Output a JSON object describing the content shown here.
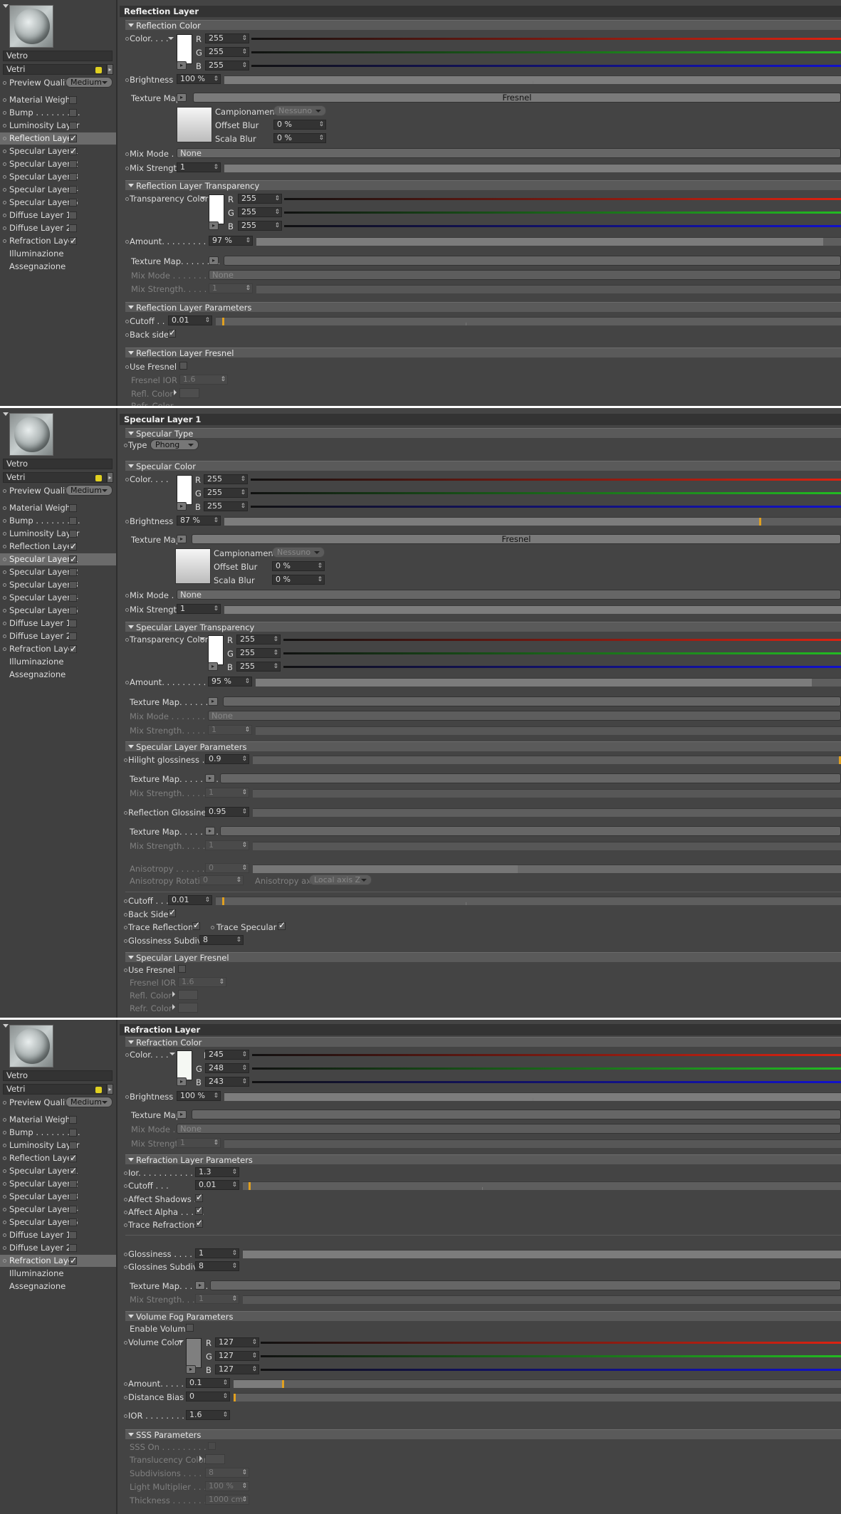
{
  "material": {
    "name": "Vetro",
    "group": "Vetri",
    "preview_quality_label": "Preview Quality",
    "preview_quality_value": "Medium"
  },
  "channels": [
    {
      "label": "Material Weight",
      "checked": false
    },
    {
      "label": "Bump . . . . . . . . .",
      "checked": false
    },
    {
      "label": "Luminosity Layer",
      "checked": false
    },
    {
      "label": "Reflection Layer",
      "checked": true
    },
    {
      "label": "Specular Layer 1",
      "checked": true
    },
    {
      "label": "Specular Layer 2",
      "checked": false
    },
    {
      "label": "Specular Layer 3",
      "checked": false
    },
    {
      "label": "Specular Layer 4",
      "checked": false
    },
    {
      "label": "Specular Layer 5",
      "checked": false
    },
    {
      "label": "Diffuse Layer 1",
      "checked": false
    },
    {
      "label": "Diffuse Layer 2",
      "checked": false
    },
    {
      "label": "Refraction Layer",
      "checked": true
    }
  ],
  "extra_items": [
    "Illuminazione",
    "Assegnazione"
  ],
  "common": {
    "color": "Color. . . .",
    "r": "R",
    "g": "G",
    "b": "B",
    "brightness": "Brightness . .",
    "texture_map": "Texture Map",
    "texture_map_dots": "Texture Map. . . . . . . .",
    "campionamento": "Campionamento",
    "nessuno": "Nessuno",
    "offset_blur": "Offset Blur",
    "scala_blur": "Scala Blur",
    "zero_pct": "0 %",
    "fresnel": "Fresnel",
    "mix_mode": "Mix Mode . .",
    "mix_mode_dots": "Mix Mode . . . . . . . . . .",
    "mix_strength": "Mix Strength",
    "mix_strength_dots": "Mix Strength. . . . . . .",
    "none": "None",
    "one": "1",
    "transparency_color": "Transparency Color",
    "amount": "Amount. . . . . . . . . . . .",
    "cutoff": "Cutoff . . .",
    "use_fresnel": "Use Fresnel",
    "fresnel_ior": "Fresnel IOR",
    "refl_color": "Refl. Color",
    "refr_color": "Refr. Color"
  },
  "reflection": {
    "title": "Reflection Layer",
    "section_color": "Reflection Color",
    "rgb": [
      "255",
      "255",
      "255"
    ],
    "brightness": "100 %",
    "brightness_frac": 1.0,
    "mix_strength": "1",
    "section_transparency": "Reflection Layer Transparency",
    "trans_rgb": [
      "255",
      "255",
      "255"
    ],
    "amount": "97 %",
    "amount_frac": 0.97,
    "section_params": "Reflection Layer Parameters",
    "cutoff": "0.01",
    "back_side": "Back side",
    "section_fresnel": "Reflection Layer Fresnel",
    "fresnel_ior": "1.6"
  },
  "specular": {
    "title": "Specular Layer 1",
    "section_type": "Specular Type",
    "type_label": "Type",
    "type_value": "Phong",
    "section_color": "Specular Color",
    "rgb": [
      "255",
      "255",
      "255"
    ],
    "brightness": "87 %",
    "brightness_frac": 0.87,
    "mix_strength": "1",
    "section_transparency": "Specular Layer Transparency",
    "trans_rgb": [
      "255",
      "255",
      "255"
    ],
    "amount": "95 %",
    "amount_frac": 0.95,
    "section_params": "Specular Layer Parameters",
    "hilight_label": "Hilight glossiness . . .",
    "hilight": "0.9",
    "refl_gloss_label": "Reflection Glossiness",
    "refl_gloss": "0.95",
    "anisotropy_label": "Anisotropy . . . . . . . . .",
    "anisotropy": "0",
    "aniso_rot_label": "Anisotropy Rotation",
    "aniso_rot": "0",
    "aniso_axis_label": "Anisotropy axis",
    "aniso_axis": "Local axis Z",
    "cutoff": "0.01",
    "back_side": "Back Side",
    "trace_reflections": "Trace Reflections",
    "trace_specular": "Trace Specular",
    "gloss_subdivs_label": "Glossiness Subdivs",
    "gloss_subdivs": "8",
    "section_fresnel": "Specular Layer Fresnel",
    "fresnel_ior": "1.6"
  },
  "refraction": {
    "title": "Refraction Layer",
    "section_color": "Refraction Color",
    "rgb": [
      "245",
      "248",
      "243"
    ],
    "brightness": "100 %",
    "brightness_frac": 1.0,
    "mix_strength": "1",
    "section_params": "Refraction Layer Parameters",
    "ior_label": "Ior. . . . . . . . . . . . .",
    "ior": "1.3",
    "cutoff": "0.01",
    "affect_shadows": "Affect Shadows . .",
    "affect_alpha": "Affect Alpha . . . . .",
    "trace_refractions": "Trace Refractions",
    "glossiness_label": "Glossiness . . . . . .",
    "glossiness": "1",
    "gloss_subdivs_label": "Glossines Subdivs",
    "gloss_subdivs": "8",
    "section_fog": "Volume Fog Parameters",
    "enable_volume": "Enable Volume",
    "volume_color": "Volume Color",
    "vol_rgb": [
      "127",
      "127",
      "127"
    ],
    "vol_amount": "0.1",
    "distance_bias_label": "Distance Bias",
    "distance_bias": "0",
    "ior2_label": "IOR . . . . . . . . .",
    "ior2": "1.6",
    "section_sss": "SSS Parameters",
    "sss_on": "SSS On . . . . . . . . . . .",
    "translucency_color": "Translucency Color",
    "subdivisions_label": "Subdivisions . . . . . . . .",
    "subdivisions": "8",
    "light_mult_label": "Light Multiplier . . . . . .",
    "light_mult": "100 %",
    "thickness_label": "Thickness . . . . . . . . .",
    "thickness": "1000 cm"
  }
}
